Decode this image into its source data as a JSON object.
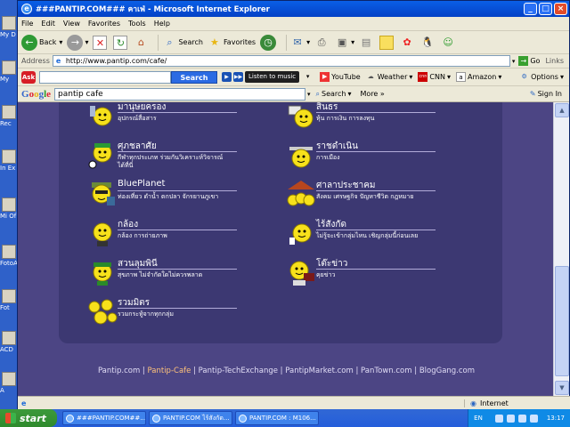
{
  "desktop": {
    "icons": [
      "My D",
      "My",
      "Rec",
      "In Ex",
      "Mi Of",
      "FotoA",
      "Fot",
      "ACD",
      "A"
    ]
  },
  "window": {
    "title": "###PANTIP.COM### คาเฟ่ - Microsoft Internet Explorer",
    "menu": [
      "File",
      "Edit",
      "View",
      "Favorites",
      "Tools",
      "Help"
    ],
    "toolbar": {
      "back": "Back",
      "search": "Search",
      "favorites": "Favorites"
    },
    "address": {
      "label": "Address",
      "url": "http://www.pantip.com/cafe/",
      "go": "Go",
      "links": "Links"
    },
    "askbar": {
      "logo": "Ask",
      "query": "",
      "search": "Search",
      "music": "Listen to music",
      "youtube": "YouTube",
      "weather": "Weather",
      "cnn": "CNN",
      "amazon": "Amazon",
      "options": "Options"
    },
    "googlebar": {
      "logo": "Google",
      "query": "pantip cafe",
      "search": "Search",
      "more": "More",
      "signin": "Sign In"
    },
    "status": {
      "zone": "Internet"
    }
  },
  "content": {
    "categories": [
      {
        "title": "มานุษยครอง",
        "desc": "อุปกรณ์สื่อสาร"
      },
      {
        "title": "สินธร",
        "desc": "หุ้น การเงิน การลงทุน"
      },
      {
        "title": "ศุภชลาศัย",
        "desc": "กีฬาทุกประเภท ร่วมกันวิเคราะห์วิจารณ์ ได้ที่นี่"
      },
      {
        "title": "ราชดำเนิน",
        "desc": "การเมือง"
      },
      {
        "title": "BluePlanet",
        "desc": "ท่องเที่ยว ดำน้ำ ตกปลา จักรยานภูเขา"
      },
      {
        "title": "ศาลาประชาคม",
        "desc": "สังคม เศรษฐกิจ ปัญหาชีวิต กฎหมาย"
      },
      {
        "title": "กล้อง",
        "desc": "กล้อง การถ่ายภาพ"
      },
      {
        "title": "ไร้สังกัด",
        "desc": "ไม่รู้จะเข้ากลุ่มไหน เชิญกลุ่มนี้ก่อนเลย"
      },
      {
        "title": "สวนลุมพินี",
        "desc": "สุขภาพ ไม่จำกัดใดไม่ควรพลาด"
      },
      {
        "title": "โต๊ะข่าว",
        "desc": "คุยข่าว"
      },
      {
        "title": "รวมมิตร",
        "desc": "รวมกระทู้จากทุกกลุ่ม"
      }
    ],
    "footer_links": [
      "Pantip.com",
      "Pantip-Cafe",
      "Pantip-TechExchange",
      "PantipMarket.com",
      "PanTown.com",
      "BlogGang.com"
    ]
  },
  "taskbar": {
    "start": "start",
    "tasks": [
      "###PANTIP.COM##...",
      "PANTIP.COM ไร้สังกัด...",
      "PANTIP.COM : M106..."
    ],
    "lang": "EN",
    "clock": "13:17"
  },
  "colors": {
    "page_bg": "#4c4584",
    "panel_bg": "#3c3872",
    "current_link": "#ffc37a"
  }
}
